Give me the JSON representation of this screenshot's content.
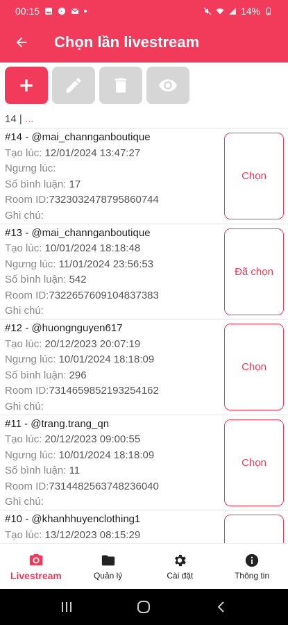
{
  "status_bar": {
    "time": "00:15",
    "battery": "14%"
  },
  "app_bar": {
    "title": "Chọn lần livestream"
  },
  "list_header": {
    "count": "14 |",
    "more": "..."
  },
  "items": [
    {
      "header": "#14 - @mai_channganboutique",
      "created_label": "Tạo lúc:",
      "created": "12/01/2024 13:47:27",
      "stopped_label": "Ngưng lúc:",
      "stopped": "",
      "comments_label": "Số bình luận:",
      "comments": "17",
      "room_label": "Room ID:",
      "room": "7323032478795860744",
      "note_label": "Ghi chú:",
      "note": "",
      "button": "Chọn"
    },
    {
      "header": "#13 - @mai_channganboutique",
      "created_label": "Tạo lúc:",
      "created": "10/01/2024 18:18:48",
      "stopped_label": "Ngưng lúc:",
      "stopped": "11/01/2024 23:56:53",
      "comments_label": "Số bình luận:",
      "comments": "542",
      "room_label": "Room ID:",
      "room": "7322657609104837383",
      "note_label": "Ghi chú:",
      "note": "",
      "button": "Đã chọn"
    },
    {
      "header": "#12 - @huongnguyen617",
      "created_label": "Tạo lúc:",
      "created": "20/12/2023 20:07:19",
      "stopped_label": "Ngưng lúc:",
      "stopped": "10/01/2024 18:18:09",
      "comments_label": "Số bình luận:",
      "comments": "296",
      "room_label": "Room ID:",
      "room": "7314659852193254162",
      "note_label": "Ghi chú:",
      "note": "",
      "button": "Chọn"
    },
    {
      "header": "#11 - @trang.trang_qn",
      "created_label": "Tạo lúc:",
      "created": "20/12/2023 09:00:55",
      "stopped_label": "Ngưng lúc:",
      "stopped": "10/01/2024 18:18:09",
      "comments_label": "Số bình luận:",
      "comments": "11",
      "room_label": "Room ID:",
      "room": "7314482563748236040",
      "note_label": "Ghi chú:",
      "note": "",
      "button": "Chọn"
    },
    {
      "header": "#10 - @khanhhuyenclothing1",
      "created_label": "Tạo lúc:",
      "created": "13/12/2023 08:15:29",
      "stopped_label": "",
      "stopped": "",
      "comments_label": "",
      "comments": "",
      "room_label": "",
      "room": "",
      "note_label": "",
      "note": "",
      "button": ""
    }
  ],
  "bottom_nav": {
    "livestream": "Livestream",
    "manage": "Quản lý",
    "settings": "Cài đặt",
    "info": "Thông tin"
  },
  "colors": {
    "accent": "#f23b5a",
    "disabled": "#d6d6d6"
  }
}
